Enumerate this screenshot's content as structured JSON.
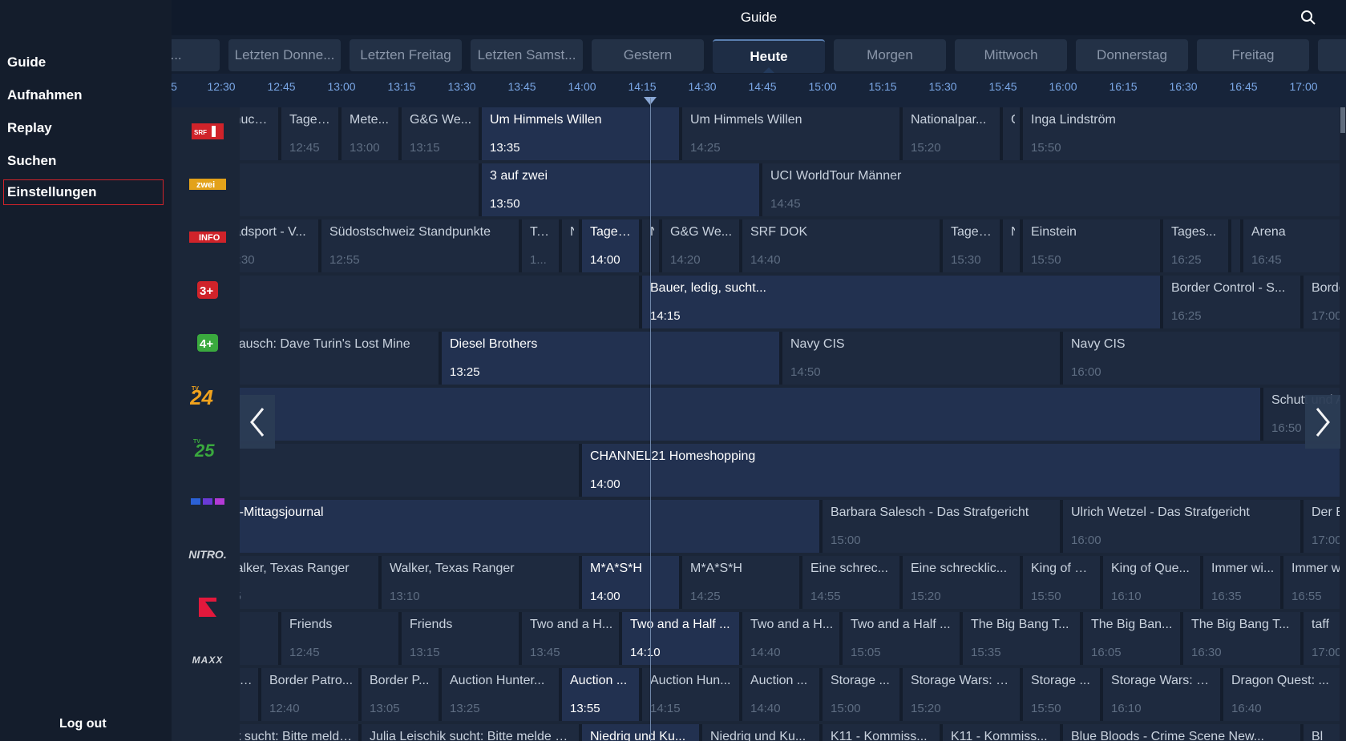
{
  "header": {
    "title": "Guide",
    "search_icon": "search-icon"
  },
  "sidebar": {
    "items": [
      {
        "label": "Guide"
      },
      {
        "label": "Aufnahmen"
      },
      {
        "label": "Replay"
      },
      {
        "label": "Suchen"
      },
      {
        "label": "Einstellungen",
        "selected": true
      }
    ],
    "logout": "Log out"
  },
  "days": [
    "ttwo...",
    "Letzten Donne...",
    "Letzten Freitag",
    "Letzten Samst...",
    "Gestern",
    "Heute",
    "Morgen",
    "Mittwoch",
    "Donnerstag",
    "Freitag",
    "Sa"
  ],
  "active_day": "Heute",
  "times": [
    "5",
    "12:30",
    "12:45",
    "13:00",
    "13:15",
    "13:30",
    "13:45",
    "14:00",
    "14:15",
    "14:30",
    "14:45",
    "15:00",
    "15:15",
    "15:30",
    "15:45",
    "16:00",
    "16:15",
    "16:30",
    "16:45",
    "17:00"
  ],
  "now_time": "14:17",
  "channels": [
    "SRF 1",
    "SRF zwei",
    "SRF info",
    "3+",
    "4+",
    "TV24",
    "TV25",
    "RTL",
    "NITRO.",
    "ProSieben",
    "MAXX"
  ],
  "colors": {
    "accent_red": "#d0232a",
    "time_blue": "#7aa7e6",
    "background": "#1b2638"
  },
  "rows": [
    [
      {
        "t": "Chuchi,...",
        "s": "",
        "st": "11:50",
        "en": "12:45"
      },
      {
        "t": "Tages...",
        "s": "12:45",
        "st": "12:45",
        "en": "13:00"
      },
      {
        "t": "Mete...",
        "s": "13:00",
        "st": "13:00",
        "en": "13:15"
      },
      {
        "t": "G&G We...",
        "s": "13:15",
        "st": "13:15",
        "en": "13:35"
      },
      {
        "t": "Um Himmels Willen",
        "s": "13:35",
        "st": "13:35",
        "en": "14:25",
        "live": true
      },
      {
        "t": "Um Himmels Willen",
        "s": "14:25",
        "st": "14:25",
        "en": "15:20"
      },
      {
        "t": "Nationalpar...",
        "s": "15:20",
        "st": "15:20",
        "en": "15:45"
      },
      {
        "t": "G",
        "s": "",
        "st": "15:45",
        "en": "15:50"
      },
      {
        "t": "Inga Lindström",
        "s": "15:50",
        "st": "15:50",
        "en": "17:30"
      }
    ],
    [
      {
        "t": "",
        "s": "",
        "st": "11:50",
        "en": "13:35"
      },
      {
        "t": "3 auf zwei",
        "s": "13:50",
        "st": "13:35",
        "en": "14:45",
        "live": true
      },
      {
        "t": "UCI WorldTour Männer",
        "s": "14:45",
        "st": "14:45",
        "en": "17:30"
      }
    ],
    [
      {
        "t": "Radsport - V...",
        "s": "12:30",
        "st": "12:20",
        "en": "12:55"
      },
      {
        "t": "Südostschweiz Standpunkte",
        "s": "12:55",
        "st": "12:55",
        "en": "13:45"
      },
      {
        "t": "Ta...",
        "s": "1...",
        "st": "13:45",
        "en": "13:55"
      },
      {
        "t": "N",
        "s": "",
        "st": "13:55",
        "en": "14:00"
      },
      {
        "t": "Tages...",
        "s": "14:00",
        "st": "14:00",
        "en": "14:15",
        "live": true
      },
      {
        "t": "N",
        "s": "",
        "st": "14:15",
        "en": "14:20"
      },
      {
        "t": "G&G We...",
        "s": "14:20",
        "st": "14:20",
        "en": "14:40"
      },
      {
        "t": "SRF DOK",
        "s": "14:40",
        "st": "14:40",
        "en": "15:30"
      },
      {
        "t": "Tages...",
        "s": "15:30",
        "st": "15:30",
        "en": "15:45"
      },
      {
        "t": "N",
        "s": "",
        "st": "15:45",
        "en": "15:50"
      },
      {
        "t": "Einstein",
        "s": "15:50",
        "st": "15:50",
        "en": "16:25"
      },
      {
        "t": "Tages...",
        "s": "16:25",
        "st": "16:25",
        "en": "16:42"
      },
      {
        "t": "N",
        "s": "",
        "st": "16:42",
        "en": "16:45"
      },
      {
        "t": "Arena",
        "s": "16:45",
        "st": "16:45",
        "en": "17:30"
      }
    ],
    [
      {
        "t": "",
        "s": "",
        "st": "11:50",
        "en": "14:15"
      },
      {
        "t": "Bauer, ledig, sucht...",
        "s": "14:15",
        "st": "14:15",
        "en": "16:25",
        "live": true
      },
      {
        "t": "Border Control - S...",
        "s": "16:25",
        "st": "16:25",
        "en": "17:00"
      },
      {
        "t": "Borde",
        "s": "17:00",
        "st": "17:00",
        "en": "17:30"
      }
    ],
    [
      {
        "t": "ldrausch: Dave Turin's Lost Mine",
        "s": "",
        "st": "11:50",
        "en": "13:25"
      },
      {
        "t": "Diesel Brothers",
        "s": "13:25",
        "st": "13:25",
        "en": "14:50",
        "live": true
      },
      {
        "t": "Navy CIS",
        "s": "14:50",
        "st": "14:50",
        "en": "16:00"
      },
      {
        "t": "Navy CIS",
        "s": "16:00",
        "st": "16:00",
        "en": "17:30"
      }
    ],
    [
      {
        "t": "",
        "s": "",
        "st": "11:50",
        "en": "16:50",
        "live": true
      },
      {
        "t": "Schutt und A",
        "s": "16:50",
        "st": "16:50",
        "en": "17:30"
      }
    ],
    [
      {
        "t": "",
        "s": "",
        "st": "11:50",
        "en": "14:00"
      },
      {
        "t": "CHANNEL21 Homeshopping",
        "s": "14:00",
        "st": "14:00",
        "en": "17:30",
        "live": true
      }
    ],
    [
      {
        "t": "TL-Mittagsjournal",
        "s": "",
        "st": "11:50",
        "en": "15:00",
        "live": true
      },
      {
        "t": "Barbara Salesch - Das Strafgericht",
        "s": "15:00",
        "st": "15:00",
        "en": "16:00"
      },
      {
        "t": "Ulrich Wetzel - Das Strafgericht",
        "s": "16:00",
        "st": "16:00",
        "en": "17:00"
      },
      {
        "t": "Der B",
        "s": "17:00",
        "st": "17:00",
        "en": "17:30"
      }
    ],
    [
      {
        "t": "Walker, Texas Ranger",
        "s": ":25",
        "st": "12:20",
        "en": "13:10"
      },
      {
        "t": "Walker, Texas Ranger",
        "s": "13:10",
        "st": "13:10",
        "en": "14:00"
      },
      {
        "t": "M*A*S*H",
        "s": "14:00",
        "st": "14:00",
        "en": "14:25",
        "live": true
      },
      {
        "t": "M*A*S*H",
        "s": "14:25",
        "st": "14:25",
        "en": "14:55"
      },
      {
        "t": "Eine schrec...",
        "s": "14:55",
        "st": "14:55",
        "en": "15:20"
      },
      {
        "t": "Eine schrecklic...",
        "s": "15:20",
        "st": "15:20",
        "en": "15:50"
      },
      {
        "t": "King of Q...",
        "s": "15:50",
        "st": "15:50",
        "en": "16:10"
      },
      {
        "t": "King of Que...",
        "s": "16:10",
        "st": "16:10",
        "en": "16:35"
      },
      {
        "t": "Immer wi...",
        "s": "16:35",
        "st": "16:35",
        "en": "16:55"
      },
      {
        "t": "Immer w",
        "s": "16:55",
        "st": "16:55",
        "en": "17:30"
      }
    ],
    [
      {
        "t": "",
        "s": "",
        "st": "11:50",
        "en": "12:45"
      },
      {
        "t": "Friends",
        "s": "12:45",
        "st": "12:45",
        "en": "13:15"
      },
      {
        "t": "Friends",
        "s": "13:15",
        "st": "13:15",
        "en": "13:45"
      },
      {
        "t": "Two and a H...",
        "s": "13:45",
        "st": "13:45",
        "en": "14:10"
      },
      {
        "t": "Two and a Half ...",
        "s": "14:10",
        "st": "14:10",
        "en": "14:40",
        "live": true
      },
      {
        "t": "Two and a H...",
        "s": "14:40",
        "st": "14:40",
        "en": "15:05"
      },
      {
        "t": "Two and a Half ...",
        "s": "15:05",
        "st": "15:05",
        "en": "15:35"
      },
      {
        "t": "The Big Bang T...",
        "s": "15:35",
        "st": "15:35",
        "en": "16:05"
      },
      {
        "t": "The Big Ban...",
        "s": "16:05",
        "st": "16:05",
        "en": "16:30"
      },
      {
        "t": "The Big Bang T...",
        "s": "16:30",
        "st": "16:30",
        "en": "17:00"
      },
      {
        "t": "taff",
        "s": "17:00",
        "st": "17:00",
        "en": "17:30"
      }
    ],
    [
      {
        "t": "trol A...",
        "s": "",
        "st": "11:50",
        "en": "12:40"
      },
      {
        "t": "Border Patro...",
        "s": "12:40",
        "st": "12:40",
        "en": "13:05"
      },
      {
        "t": "Border P...",
        "s": "13:05",
        "st": "13:05",
        "en": "13:25"
      },
      {
        "t": "Auction Hunter...",
        "s": "13:25",
        "st": "13:25",
        "en": "13:55"
      },
      {
        "t": "Auction ...",
        "s": "13:55",
        "st": "13:55",
        "en": "14:15",
        "live": true
      },
      {
        "t": "Auction Hun...",
        "s": "14:15",
        "st": "14:15",
        "en": "14:40"
      },
      {
        "t": "Auction ...",
        "s": "14:40",
        "st": "14:40",
        "en": "15:00"
      },
      {
        "t": "Storage ...",
        "s": "15:00",
        "st": "15:00",
        "en": "15:20"
      },
      {
        "t": "Storage Wars: N...",
        "s": "15:20",
        "st": "15:20",
        "en": "15:50"
      },
      {
        "t": "Storage ...",
        "s": "15:50",
        "st": "15:50",
        "en": "16:10"
      },
      {
        "t": "Storage Wars: N...",
        "s": "16:10",
        "st": "16:10",
        "en": "16:40"
      },
      {
        "t": "Dragon Quest: ...",
        "s": "16:40",
        "st": "16:40",
        "en": "17:10"
      }
    ],
    [
      {
        "t": "hik sucht: Bitte melde dich",
        "s": "",
        "st": "11:50",
        "en": "13:05"
      },
      {
        "t": "Julia Leischik sucht: Bitte melde dich",
        "s": "",
        "st": "13:05",
        "en": "14:00"
      },
      {
        "t": "Niedrig und Ku...",
        "s": "",
        "st": "14:00",
        "en": "14:30",
        "live": true
      },
      {
        "t": "Niedrig und Ku...",
        "s": "",
        "st": "14:30",
        "en": "15:00"
      },
      {
        "t": "K11 - Kommiss...",
        "s": "",
        "st": "15:00",
        "en": "15:30"
      },
      {
        "t": "K11 - Kommiss...",
        "s": "",
        "st": "15:30",
        "en": "16:00"
      },
      {
        "t": "Blue Bloods - Crime Scene New...",
        "s": "",
        "st": "16:00",
        "en": "17:00"
      },
      {
        "t": "Bl",
        "s": "",
        "st": "17:00",
        "en": "17:30"
      }
    ]
  ]
}
